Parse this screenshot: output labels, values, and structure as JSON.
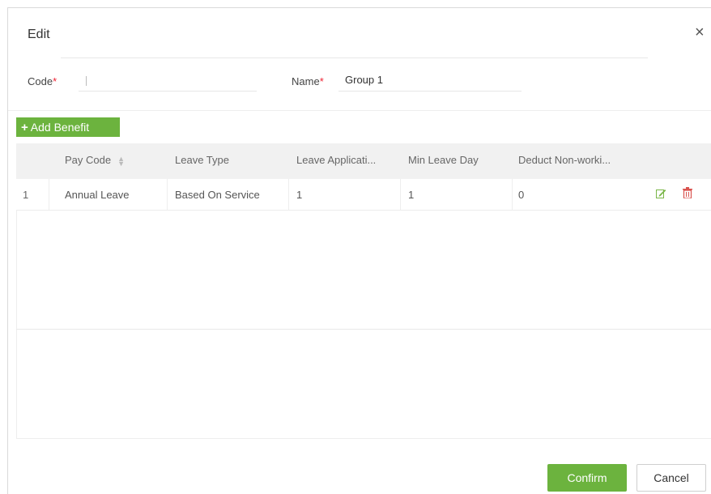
{
  "dialog": {
    "title": "Edit",
    "close_glyph": "×"
  },
  "form": {
    "code_label": "Code",
    "code_value": "",
    "name_label": "Name",
    "name_value": "Group 1",
    "required_mark": "*"
  },
  "toolbar": {
    "add_benefit_label": "Add Benefit",
    "add_plus": "+"
  },
  "table": {
    "columns": [
      "Pay Code",
      "Leave Type",
      "Leave Applicati...",
      "Min Leave Day",
      "Deduct Non-worki..."
    ],
    "rows": [
      {
        "index": "1",
        "pay_code": "Annual Leave",
        "leave_type": "Based On Service",
        "leave_application": "1",
        "min_leave_day": "1",
        "deduct_non_working": "0"
      }
    ]
  },
  "footer": {
    "confirm_label": "Confirm",
    "cancel_label": "Cancel"
  },
  "colors": {
    "accent_green": "#6cb33e",
    "delete_red": "#d9534f",
    "edit_green": "#7ab648"
  },
  "icons": {
    "sort": "sort-icon",
    "edit": "edit-icon",
    "delete": "trash-icon",
    "close": "close-icon"
  }
}
